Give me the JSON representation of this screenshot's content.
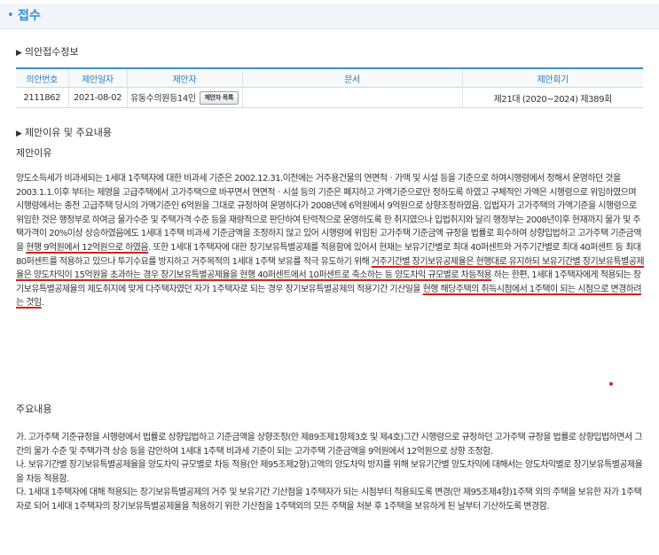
{
  "header": {
    "title": "접수"
  },
  "receipt_info": {
    "section_title": "의안접수정보",
    "columns": [
      "의안번호",
      "제안일자",
      "제안자",
      "문서",
      "제안회기"
    ],
    "row": {
      "bill_no": "2111862",
      "date": "2021-08-02",
      "proposer": "유동수의원등14인",
      "proposer_button": "제안자 목록",
      "document": "",
      "session": "제21대 (2020~2024) 제389회"
    }
  },
  "reasons": {
    "section_title": "제안이유 및 주요내용",
    "reason_label": "제안이유",
    "reason_parts": [
      "양도소득세가 비과세되는 1세대 1주택자에 대한 비과세 기준은 2002.12.31.이전에는 거주용건물의 연면적ㆍ가액 및 시설 등을 기준으로 하여시행령에서 정해서 운영하던 것을 2003.1.1.이후 부터는 제영을 고급주택에서 고가주택으로 바꾸면서 연면적ㆍ시설 등의 기준은 폐지하고 가액기준으로만 정하도록 하였고 구체적인 가액은 시행령으로 위임하였으며 시행령에서는 종전 고급주택 당시의 가액기준인 6억원을 그대로 규정하여 운영하다가 2008년에 6억원에서 9억원으로 상향조정하였음. 입법자가 고가주택의 가액기준을 시행령으로 위임한 것은 행정부로 하여금 물가수준 및 주택가격 수준 등을 재량적으로 판단하여 탄력적으로 운영하도록 한 취지였으나 입법취지와 달리 행정부는 2008년이후 현재까지 물가 및 주택가격이 20%이상 상승하였음에도 1세대 1주택 비과세 기준금액을 조정하지 않고 있어 시행령에 위임된 고가주택 기준금액 규정을 법률로 회수하여 상향입법하고 고가주택 기준금액을 ",
      "현행 9억원에서 12억원으로 하였음",
      ". 또한 1세대 1주택자에 대한 장기보유특별공제를 적용함에 있어서 현재는 보유기간별로 최대 40퍼센트와 거주기간별로 최대 40퍼센트 등 최대 80퍼센트를 적용하고 있으나 투기수요를 방지하고 거주목적의 1세대 1주택 보유를 적극 유도하기 위해 ",
      "거주기간별 장기보유공제율은 현행대로 유지하되 보유기간별 장기보유특별공제율은 양도차익이 15억원을 초과하는 경우 장기보유특별공제율을 현행 40퍼센트에서 10퍼센트로 축소하는 등 양도차익 규모별로 차등적용",
      " 하는 한편, 1세대 1주택자에게 적용되는 장기보유특별공제율의 제도취지에 맞게 다주택자였던 자가 1주택자로 되는 경우 장기보유특별공제의 적용기간 기산일을 ",
      "현행 해당주택의 취득시점에서 1주택이 되는 시점으로 변경하려는 것임",
      "."
    ],
    "main_label": "주요내용",
    "main_items": [
      "가. 고가주택 기준규정을 시행령에서 법률로 상향입법하고 기준금액을 상향조정(안 제89조제1항제3호 및 제4호)그간 시행령으로 규정하던 고가주택 규정을 법률로 상향입법하면서 그간의 물가 수준 및 주택가격 상승 등을 감안하여 1세대 1주택 비과세 기준이 되는 고가주택 기준금액을 9억원에서 12억원으로 상향 조정함.",
      "나. 보유기간별 장기보유특별공제율을 양도차익 규모별로 차등 적용(안 제95조제2항)고액의 양도차익 방지를 위해 보유기간별 양도차익에 대해서는 양도차익별로 장기보유특별공제율을 차등 적용함.",
      "다. 1세대 1주택자에 대해 적용되는 장기보유특별공제의 거주 및 보유기간 기산점을 1주택자가 되는 시점부터 적용되도록 변경(안 제95조제4항)1주택 외의 주택을 보유한 자가 1주택자로 되어 1세대 1주택자의 장기보유특별공제율을 적용하기 위한 기산점을 1주택외의 모든 주택을 처분 후 1주택을 보유하게 된 날부터 기산하도록 변경함."
    ]
  },
  "colors": {
    "accent": "#2a8fd6",
    "header_bg": "#f1f5f9",
    "underline": "#d81e1e"
  }
}
